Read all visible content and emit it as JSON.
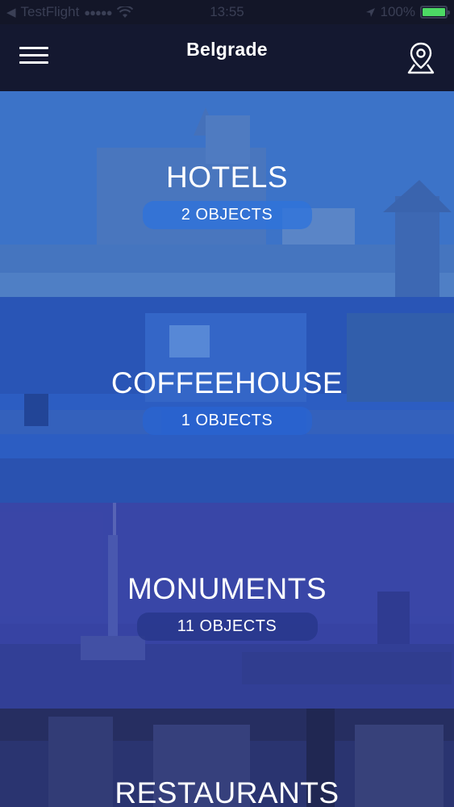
{
  "status_bar": {
    "carrier": "TestFlight",
    "time": "13:55",
    "battery_percent": "100%",
    "battery_color": "#4cd964"
  },
  "nav": {
    "title": "Belgrade",
    "menu_icon": "hamburger-menu-icon",
    "map_icon": "map-pin-icon"
  },
  "categories": [
    {
      "title": "HOTELS",
      "count": "2 OBJECTS"
    },
    {
      "title": "COFFEEHOUSE",
      "count": "1 OBJECTS"
    },
    {
      "title": "MONUMENTS",
      "count": "11 OBJECTS"
    },
    {
      "title": "RESTAURANTS",
      "count": ""
    }
  ],
  "colors": {
    "nav_background": "#141830",
    "hotels_tint": "#3b73c9",
    "coffeehouse_tint": "#2c5dc2",
    "monuments_tint": "#333f9e",
    "restaurants_tint": "#2a3570"
  }
}
